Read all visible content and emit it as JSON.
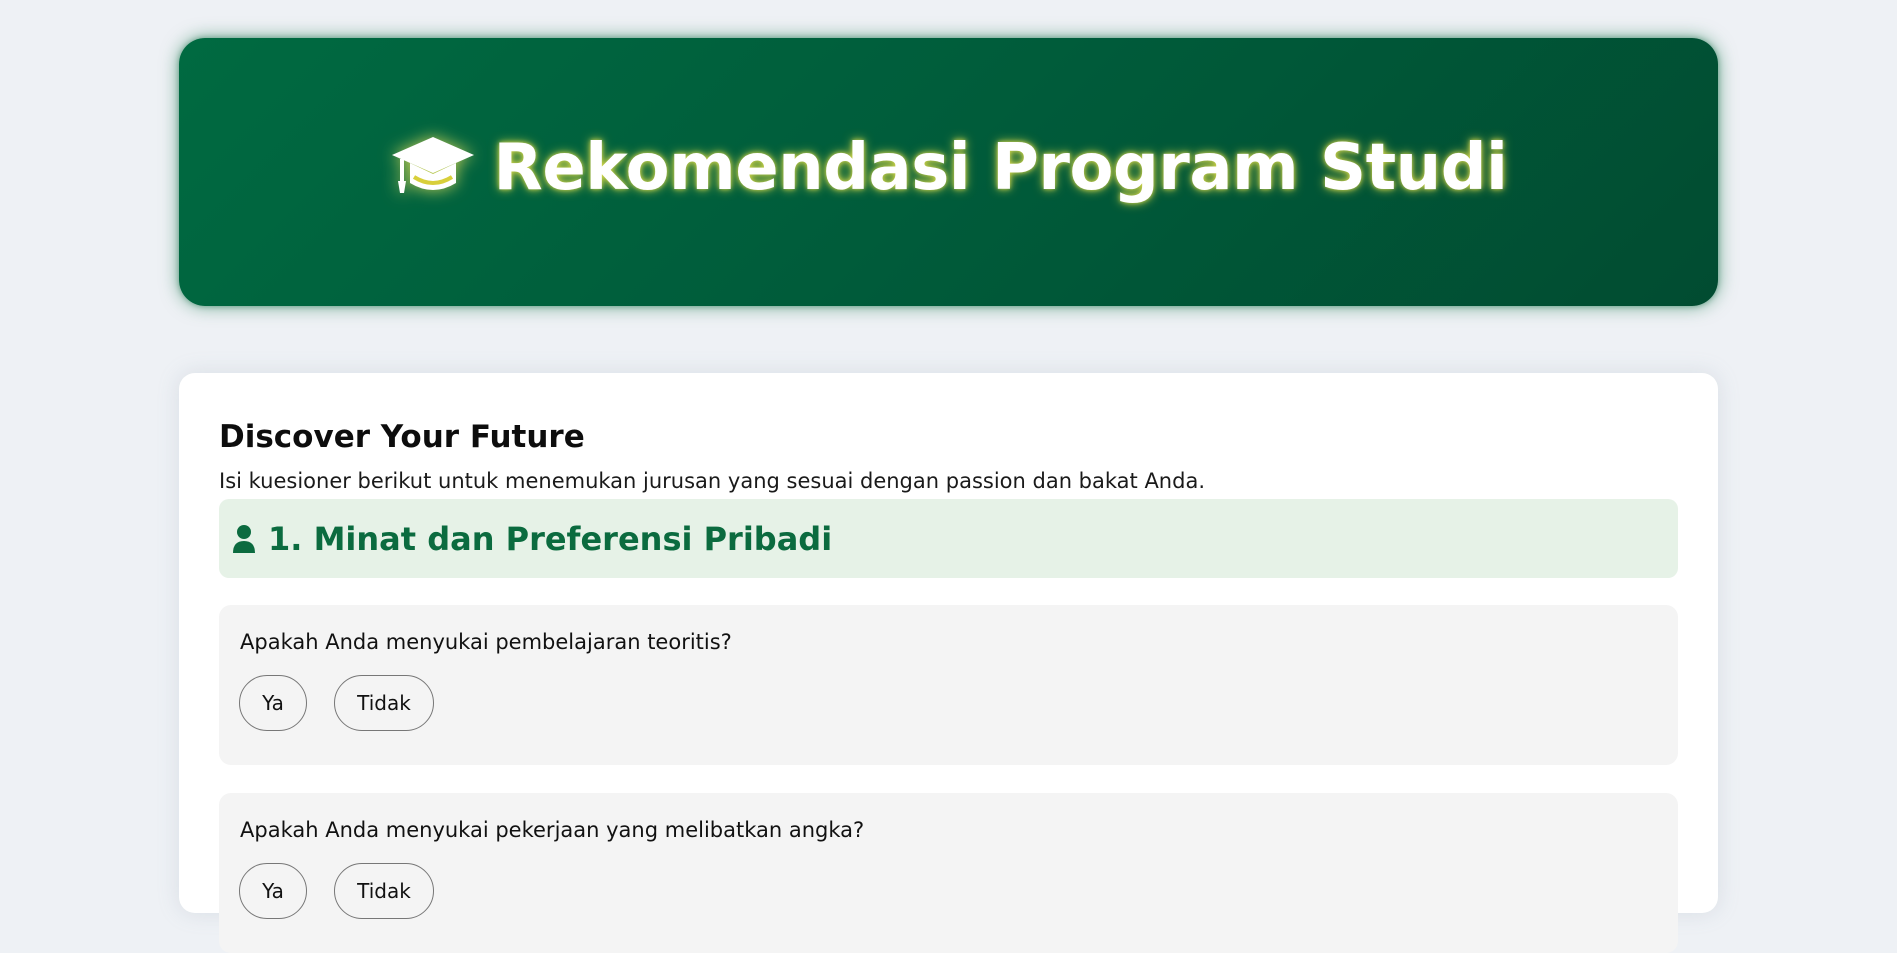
{
  "hero": {
    "icon": "graduation-cap-icon",
    "title": "Rekomendasi Program Studi"
  },
  "card": {
    "title": "Discover Your Future",
    "subtitle": "Isi kuesioner berikut untuk menemukan jurusan yang sesuai dengan passion dan bakat Anda."
  },
  "section": {
    "icon": "person-icon",
    "title": "1. Minat dan Preferensi Pribadi"
  },
  "questions": [
    {
      "text": "Apakah Anda menyukai pembelajaran teoritis?",
      "options": [
        "Ya",
        "Tidak"
      ]
    },
    {
      "text": "Apakah Anda menyukai pekerjaan yang melibatkan angka?",
      "options": [
        "Ya",
        "Tidak"
      ]
    }
  ],
  "colors": {
    "page_background": "#eef1f5",
    "hero_green": "#005d3b",
    "accent_green": "#0b6b3f",
    "section_background": "#e6f2e7",
    "question_background": "#f4f4f4",
    "glow_yellow": "#e4e15a"
  }
}
